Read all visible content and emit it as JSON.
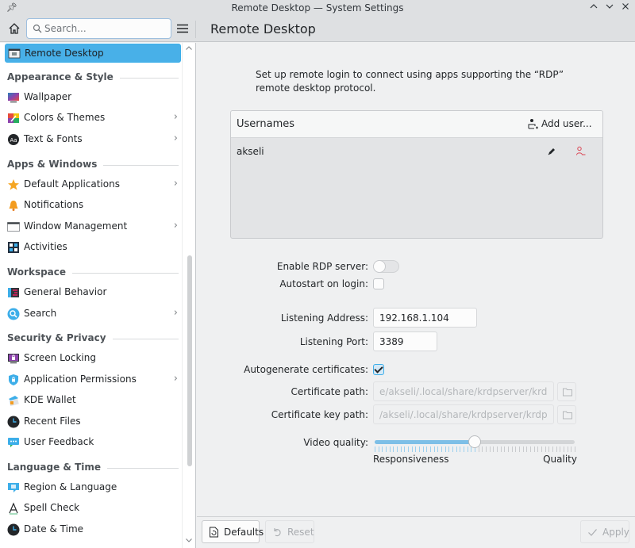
{
  "window": {
    "title": "Remote Desktop — System Settings",
    "buttons": [
      "minimize",
      "maximize",
      "close"
    ]
  },
  "header": {
    "search_placeholder": "Search...",
    "search_value": "",
    "page_title": "Remote Desktop"
  },
  "sidebar": {
    "active_item": {
      "label": "Remote Desktop",
      "icon": "remote-desktop-icon"
    },
    "sections": [
      {
        "title": "Appearance & Style",
        "items": [
          {
            "label": "Wallpaper",
            "icon": "wallpaper-icon",
            "has_children": false
          },
          {
            "label": "Colors & Themes",
            "icon": "colors-themes-icon",
            "has_children": true
          },
          {
            "label": "Text & Fonts",
            "icon": "text-fonts-icon",
            "has_children": true
          }
        ]
      },
      {
        "title": "Apps & Windows",
        "items": [
          {
            "label": "Default Applications",
            "icon": "star-icon",
            "has_children": true
          },
          {
            "label": "Notifications",
            "icon": "bell-icon",
            "has_children": false
          },
          {
            "label": "Window Management",
            "icon": "window-icon",
            "has_children": true
          },
          {
            "label": "Activities",
            "icon": "activities-icon",
            "has_children": false
          }
        ]
      },
      {
        "title": "Workspace",
        "items": [
          {
            "label": "General Behavior",
            "icon": "general-behavior-icon",
            "has_children": false
          },
          {
            "label": "Search",
            "icon": "search-icon",
            "has_children": true
          }
        ]
      },
      {
        "title": "Security & Privacy",
        "items": [
          {
            "label": "Screen Locking",
            "icon": "screen-lock-icon",
            "has_children": false
          },
          {
            "label": "Application Permissions",
            "icon": "shield-icon",
            "has_children": true
          },
          {
            "label": "KDE Wallet",
            "icon": "wallet-icon",
            "has_children": false
          },
          {
            "label": "Recent Files",
            "icon": "clock-icon",
            "has_children": false
          },
          {
            "label": "User Feedback",
            "icon": "feedback-icon",
            "has_children": false
          }
        ]
      },
      {
        "title": "Language & Time",
        "items": [
          {
            "label": "Region & Language",
            "icon": "region-icon",
            "has_children": false
          },
          {
            "label": "Spell Check",
            "icon": "spell-check-icon",
            "has_children": false
          },
          {
            "label": "Date & Time",
            "icon": "clock-icon",
            "has_children": false
          }
        ]
      }
    ]
  },
  "main": {
    "description": "Set up remote login to connect using apps supporting the “RDP” remote desktop protocol.",
    "users": {
      "header": "Usernames",
      "add_label": "Add user...",
      "rows": [
        {
          "name": "akseli"
        }
      ]
    },
    "enable_rdp": {
      "label": "Enable RDP server:",
      "value": false
    },
    "autostart": {
      "label": "Autostart on login:",
      "value": false
    },
    "listening_address": {
      "label": "Listening Address:",
      "value": "192.168.1.104"
    },
    "listening_port": {
      "label": "Listening Port:",
      "value": "3389"
    },
    "autogenerate": {
      "label": "Autogenerate certificates:",
      "value": true
    },
    "cert_path": {
      "label": "Certificate path:",
      "value": "e/akseli/.local/share/krdpserver/krdp.crt"
    },
    "cert_key_path": {
      "label": "Certificate key path:",
      "value": "/akseli/.local/share/krdpserver/krdp.key"
    },
    "video_quality": {
      "label": "Video quality:",
      "value_percent": 50,
      "min_label": "Responsiveness",
      "max_label": "Quality"
    }
  },
  "footer": {
    "defaults_label": "Defaults",
    "reset_label": "Reset",
    "apply_label": "Apply"
  },
  "colors": {
    "accent": "#3daee9",
    "selection": "#48b0e8",
    "remove_user": "#da4453"
  }
}
